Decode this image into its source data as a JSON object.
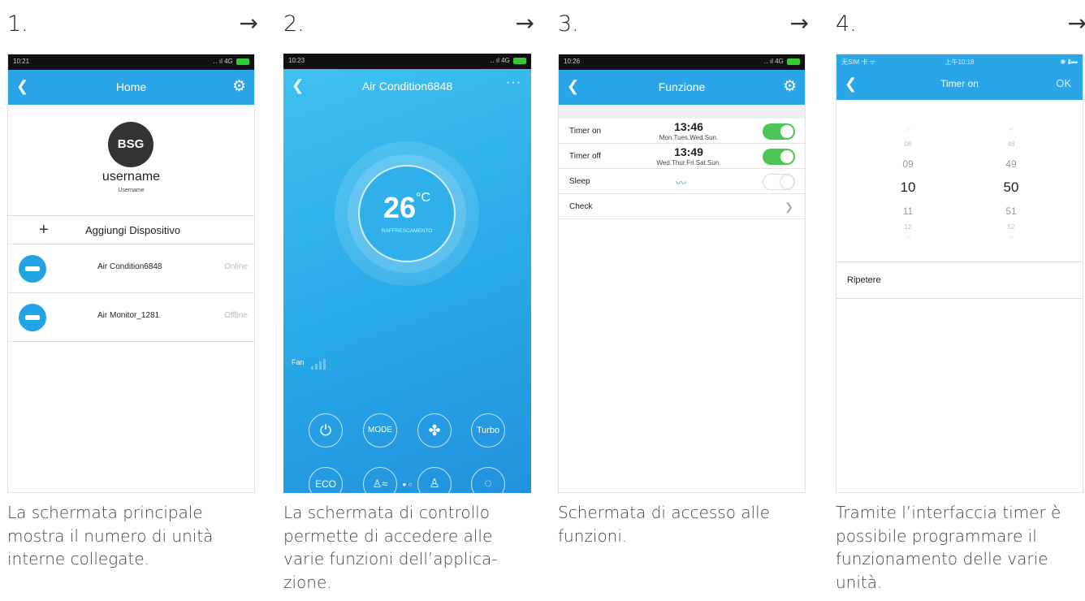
{
  "steps": [
    {
      "number": "1.",
      "arrow": "→",
      "caption": "La schermata principale mostra il numero di unità interne collegate."
    },
    {
      "number": "2.",
      "arrow": "→",
      "caption": "La schermata di controllo permette di accedere alle varie funzioni dell’applica-zione."
    },
    {
      "number": "3.",
      "arrow": "→",
      "caption": "Schermata di accesso alle funzioni."
    },
    {
      "number": "4.",
      "arrow": "→",
      "caption": "Tramite l’interfaccia timer è possibile programmare il funzionamento delle varie unità."
    }
  ],
  "screen1": {
    "time": "10:21",
    "title": "Home",
    "avatar": "BSG",
    "username": "username",
    "username_small": "Username",
    "add_label": "Aggiungi Dispositivo",
    "devices": [
      {
        "name": "Air Condition6848",
        "status": "Online"
      },
      {
        "name": "Air Monitor_1281",
        "status": "Offline"
      }
    ]
  },
  "screen2": {
    "time": "10:23",
    "title": "Air Condition6848",
    "more": "···",
    "temperature": "26",
    "unit": "°C",
    "mode": "RAFFRESCAMENTO",
    "fan_label": "Fan",
    "controls": [
      "⏻",
      "MODE",
      "✤",
      "Turbo",
      "ECO",
      "♙≈",
      "♙",
      "◌"
    ]
  },
  "screen3": {
    "time": "10:26",
    "title": "Funzione",
    "timer_on": {
      "label": "Timer on",
      "time": "13:46",
      "days": "Mon.Tues.Wed.Sun."
    },
    "timer_off": {
      "label": "Timer off",
      "time": "13:49",
      "days": "Wed.Thur.Fri.Sat.Sun."
    },
    "sleep_label": "Sleep",
    "check_label": "Check"
  },
  "screen4": {
    "status_left": "无SIM 卡 ᯤ",
    "status_time": "上午10:18",
    "title": "Timer on",
    "ok": "OK",
    "hours": [
      "07",
      "08",
      "09",
      "10",
      "11",
      "12",
      "13"
    ],
    "minutes": [
      "47",
      "48",
      "49",
      "50",
      "51",
      "52",
      "53"
    ],
    "repeat_label": "Ripetere"
  }
}
